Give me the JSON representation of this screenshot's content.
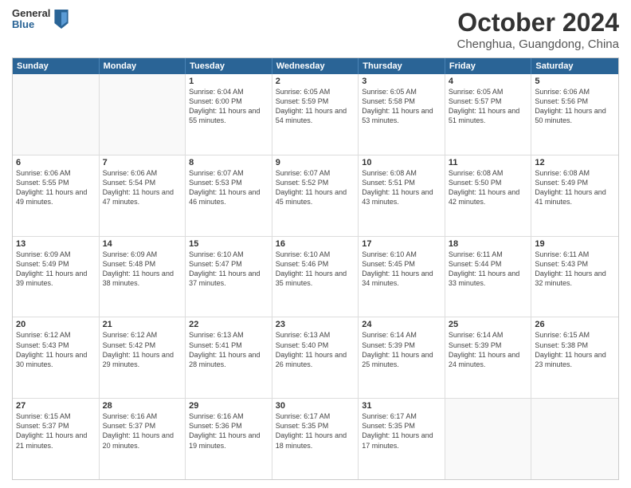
{
  "logo": {
    "general": "General",
    "blue": "Blue"
  },
  "header": {
    "month": "October 2024",
    "location": "Chenghua, Guangdong, China"
  },
  "weekdays": [
    "Sunday",
    "Monday",
    "Tuesday",
    "Wednesday",
    "Thursday",
    "Friday",
    "Saturday"
  ],
  "weeks": [
    [
      {
        "day": "",
        "sunrise": "",
        "sunset": "",
        "daylight": ""
      },
      {
        "day": "",
        "sunrise": "",
        "sunset": "",
        "daylight": ""
      },
      {
        "day": "1",
        "sunrise": "Sunrise: 6:04 AM",
        "sunset": "Sunset: 6:00 PM",
        "daylight": "Daylight: 11 hours and 55 minutes."
      },
      {
        "day": "2",
        "sunrise": "Sunrise: 6:05 AM",
        "sunset": "Sunset: 5:59 PM",
        "daylight": "Daylight: 11 hours and 54 minutes."
      },
      {
        "day": "3",
        "sunrise": "Sunrise: 6:05 AM",
        "sunset": "Sunset: 5:58 PM",
        "daylight": "Daylight: 11 hours and 53 minutes."
      },
      {
        "day": "4",
        "sunrise": "Sunrise: 6:05 AM",
        "sunset": "Sunset: 5:57 PM",
        "daylight": "Daylight: 11 hours and 51 minutes."
      },
      {
        "day": "5",
        "sunrise": "Sunrise: 6:06 AM",
        "sunset": "Sunset: 5:56 PM",
        "daylight": "Daylight: 11 hours and 50 minutes."
      }
    ],
    [
      {
        "day": "6",
        "sunrise": "Sunrise: 6:06 AM",
        "sunset": "Sunset: 5:55 PM",
        "daylight": "Daylight: 11 hours and 49 minutes."
      },
      {
        "day": "7",
        "sunrise": "Sunrise: 6:06 AM",
        "sunset": "Sunset: 5:54 PM",
        "daylight": "Daylight: 11 hours and 47 minutes."
      },
      {
        "day": "8",
        "sunrise": "Sunrise: 6:07 AM",
        "sunset": "Sunset: 5:53 PM",
        "daylight": "Daylight: 11 hours and 46 minutes."
      },
      {
        "day": "9",
        "sunrise": "Sunrise: 6:07 AM",
        "sunset": "Sunset: 5:52 PM",
        "daylight": "Daylight: 11 hours and 45 minutes."
      },
      {
        "day": "10",
        "sunrise": "Sunrise: 6:08 AM",
        "sunset": "Sunset: 5:51 PM",
        "daylight": "Daylight: 11 hours and 43 minutes."
      },
      {
        "day": "11",
        "sunrise": "Sunrise: 6:08 AM",
        "sunset": "Sunset: 5:50 PM",
        "daylight": "Daylight: 11 hours and 42 minutes."
      },
      {
        "day": "12",
        "sunrise": "Sunrise: 6:08 AM",
        "sunset": "Sunset: 5:49 PM",
        "daylight": "Daylight: 11 hours and 41 minutes."
      }
    ],
    [
      {
        "day": "13",
        "sunrise": "Sunrise: 6:09 AM",
        "sunset": "Sunset: 5:49 PM",
        "daylight": "Daylight: 11 hours and 39 minutes."
      },
      {
        "day": "14",
        "sunrise": "Sunrise: 6:09 AM",
        "sunset": "Sunset: 5:48 PM",
        "daylight": "Daylight: 11 hours and 38 minutes."
      },
      {
        "day": "15",
        "sunrise": "Sunrise: 6:10 AM",
        "sunset": "Sunset: 5:47 PM",
        "daylight": "Daylight: 11 hours and 37 minutes."
      },
      {
        "day": "16",
        "sunrise": "Sunrise: 6:10 AM",
        "sunset": "Sunset: 5:46 PM",
        "daylight": "Daylight: 11 hours and 35 minutes."
      },
      {
        "day": "17",
        "sunrise": "Sunrise: 6:10 AM",
        "sunset": "Sunset: 5:45 PM",
        "daylight": "Daylight: 11 hours and 34 minutes."
      },
      {
        "day": "18",
        "sunrise": "Sunrise: 6:11 AM",
        "sunset": "Sunset: 5:44 PM",
        "daylight": "Daylight: 11 hours and 33 minutes."
      },
      {
        "day": "19",
        "sunrise": "Sunrise: 6:11 AM",
        "sunset": "Sunset: 5:43 PM",
        "daylight": "Daylight: 11 hours and 32 minutes."
      }
    ],
    [
      {
        "day": "20",
        "sunrise": "Sunrise: 6:12 AM",
        "sunset": "Sunset: 5:43 PM",
        "daylight": "Daylight: 11 hours and 30 minutes."
      },
      {
        "day": "21",
        "sunrise": "Sunrise: 6:12 AM",
        "sunset": "Sunset: 5:42 PM",
        "daylight": "Daylight: 11 hours and 29 minutes."
      },
      {
        "day": "22",
        "sunrise": "Sunrise: 6:13 AM",
        "sunset": "Sunset: 5:41 PM",
        "daylight": "Daylight: 11 hours and 28 minutes."
      },
      {
        "day": "23",
        "sunrise": "Sunrise: 6:13 AM",
        "sunset": "Sunset: 5:40 PM",
        "daylight": "Daylight: 11 hours and 26 minutes."
      },
      {
        "day": "24",
        "sunrise": "Sunrise: 6:14 AM",
        "sunset": "Sunset: 5:39 PM",
        "daylight": "Daylight: 11 hours and 25 minutes."
      },
      {
        "day": "25",
        "sunrise": "Sunrise: 6:14 AM",
        "sunset": "Sunset: 5:39 PM",
        "daylight": "Daylight: 11 hours and 24 minutes."
      },
      {
        "day": "26",
        "sunrise": "Sunrise: 6:15 AM",
        "sunset": "Sunset: 5:38 PM",
        "daylight": "Daylight: 11 hours and 23 minutes."
      }
    ],
    [
      {
        "day": "27",
        "sunrise": "Sunrise: 6:15 AM",
        "sunset": "Sunset: 5:37 PM",
        "daylight": "Daylight: 11 hours and 21 minutes."
      },
      {
        "day": "28",
        "sunrise": "Sunrise: 6:16 AM",
        "sunset": "Sunset: 5:37 PM",
        "daylight": "Daylight: 11 hours and 20 minutes."
      },
      {
        "day": "29",
        "sunrise": "Sunrise: 6:16 AM",
        "sunset": "Sunset: 5:36 PM",
        "daylight": "Daylight: 11 hours and 19 minutes."
      },
      {
        "day": "30",
        "sunrise": "Sunrise: 6:17 AM",
        "sunset": "Sunset: 5:35 PM",
        "daylight": "Daylight: 11 hours and 18 minutes."
      },
      {
        "day": "31",
        "sunrise": "Sunrise: 6:17 AM",
        "sunset": "Sunset: 5:35 PM",
        "daylight": "Daylight: 11 hours and 17 minutes."
      },
      {
        "day": "",
        "sunrise": "",
        "sunset": "",
        "daylight": ""
      },
      {
        "day": "",
        "sunrise": "",
        "sunset": "",
        "daylight": ""
      }
    ]
  ]
}
